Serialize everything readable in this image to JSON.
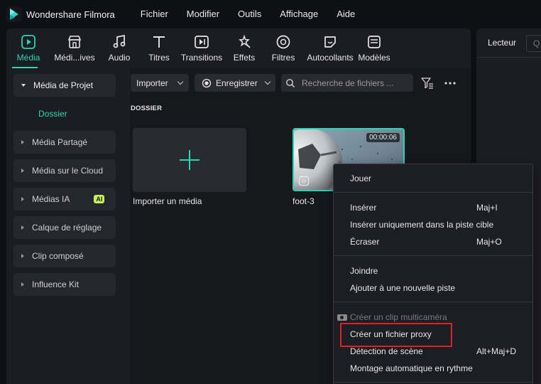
{
  "app": {
    "name": "Wondershare Filmora",
    "menu": [
      "Fichier",
      "Modifier",
      "Outils",
      "Affichage",
      "Aide"
    ]
  },
  "tabs": [
    {
      "label": "Média",
      "icon": "media-icon",
      "active": true
    },
    {
      "label": "Médi...ives",
      "icon": "stock-media-icon",
      "active": false
    },
    {
      "label": "Audio",
      "icon": "audio-icon",
      "active": false
    },
    {
      "label": "Titres",
      "icon": "titles-icon",
      "active": false
    },
    {
      "label": "Transitions",
      "icon": "transitions-icon",
      "active": false
    },
    {
      "label": "Effets",
      "icon": "effects-icon",
      "active": false
    },
    {
      "label": "Filtres",
      "icon": "filters-icon",
      "active": false
    },
    {
      "label": "Autocollants",
      "icon": "stickers-icon",
      "active": false
    },
    {
      "label": "Modèles",
      "icon": "templates-icon",
      "active": false
    }
  ],
  "sidebar": {
    "items": [
      {
        "label": "Média de Projet",
        "open": true
      },
      {
        "label": "Média Partagé"
      },
      {
        "label": "Média sur le Cloud"
      },
      {
        "label": "Médias IA",
        "badge": "AI"
      },
      {
        "label": "Calque de réglage"
      },
      {
        "label": "Clip composé"
      },
      {
        "label": "Influence Kit"
      }
    ],
    "sub_item": "Dossier"
  },
  "toolbar": {
    "import_label": "Importer",
    "record_label": "Enregistrer",
    "search_placeholder": "Recherche de fichiers ..."
  },
  "content": {
    "section_label": "DOSSIER",
    "import_tile_label": "Importer un média",
    "clip": {
      "name": "foot-3",
      "duration": "00:00:06"
    }
  },
  "right_panel": {
    "tab_label": "Lecteur",
    "search_text": "Q"
  },
  "context_menu": {
    "items": [
      {
        "label": "Jouer",
        "shortcut": ""
      },
      {
        "label": "Insérer",
        "shortcut": "Maj+I"
      },
      {
        "label": "Insérer uniquement dans la piste cible",
        "shortcut": ""
      },
      {
        "label": "Écraser",
        "shortcut": "Maj+O"
      },
      {
        "label": "Joindre",
        "shortcut": ""
      },
      {
        "label": "Ajouter à une nouvelle piste",
        "shortcut": ""
      },
      {
        "label": "Créer un clip multicaméra",
        "shortcut": "",
        "disabled": true
      },
      {
        "label": "Créer un fichier proxy",
        "shortcut": "",
        "highlighted": true
      },
      {
        "label": "Détection de scène",
        "shortcut": "Alt+Maj+D"
      },
      {
        "label": "Montage automatique en rythme",
        "shortcut": ""
      }
    ]
  },
  "colors": {
    "accent": "#27d7b3",
    "highlight_box": "#e01f26",
    "ai_badge": "#c9f25a"
  }
}
